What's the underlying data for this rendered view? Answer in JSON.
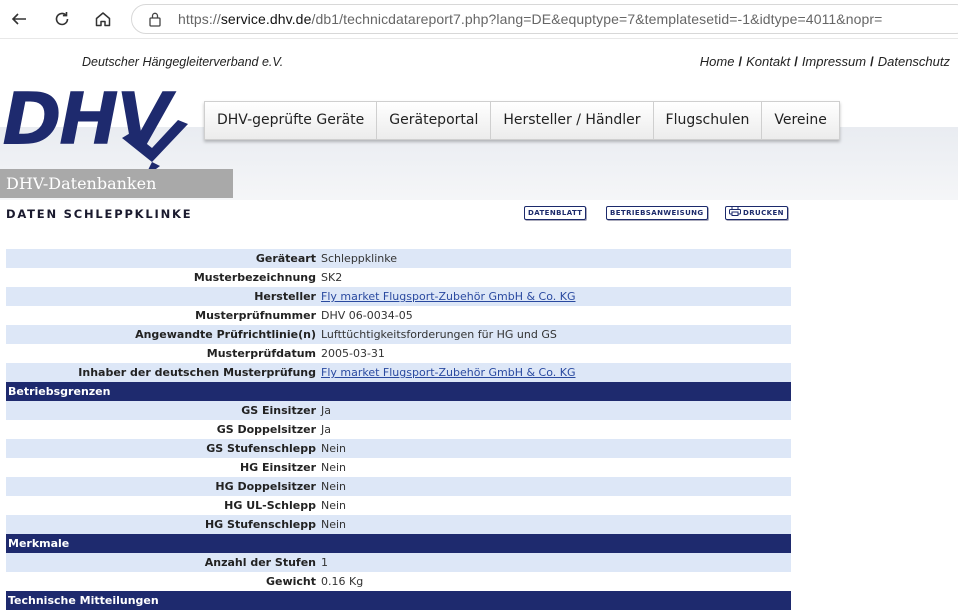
{
  "browser": {
    "url_prefix": "https://",
    "url_domain": "service.dhv.de",
    "url_rest": "/db1/technicdatareport7.php?lang=DE&equptype=7&templatesetid=-1&idtype=4011&nopr="
  },
  "site": {
    "org_name": "Deutscher Hängegleiterverband e.V.",
    "logo_text": "DHV",
    "db_title": "DHV-Datenbanken",
    "top_links": [
      "Home",
      "Kontakt",
      "Impressum",
      "Datenschutz"
    ],
    "menu": [
      "DHV-geprüfte Geräte",
      "Geräteportal",
      "Hersteller / Händler",
      "Flugschulen",
      "Vereine"
    ]
  },
  "page": {
    "title": "DATEN SCHLEPPKLINKE",
    "btn_datenblatt": "DATENBLATT",
    "btn_betrieb": "BETRIEBSANWEISUNG",
    "btn_drucken": "DRUCKEN"
  },
  "rows": [
    {
      "label": "Geräteart",
      "value": "Schleppklinke"
    },
    {
      "label": "Musterbezeichnung",
      "value": "SK2"
    },
    {
      "label": "Hersteller",
      "value": "Fly market Flugsport-Zubehör GmbH & Co. KG",
      "link": true
    },
    {
      "label": "Musterprüfnummer",
      "value": "DHV 06-0034-05"
    },
    {
      "label": "Angewandte Prüfrichtlinie(n)",
      "value": "Lufttüchtigkeitsforderungen für HG und GS"
    },
    {
      "label": "Musterprüfdatum",
      "value": "2005-03-31"
    },
    {
      "label": "Inhaber der deutschen Musterprüfung",
      "value": "Fly market Flugsport-Zubehör GmbH & Co. KG",
      "link": true
    },
    {
      "section": "Betriebsgrenzen"
    },
    {
      "label": "GS Einsitzer",
      "value": "Ja"
    },
    {
      "label": "GS Doppelsitzer",
      "value": "Ja"
    },
    {
      "label": "GS Stufenschlepp",
      "value": "Nein"
    },
    {
      "label": "HG Einsitzer",
      "value": "Nein"
    },
    {
      "label": "HG Doppelsitzer",
      "value": "Nein"
    },
    {
      "label": "HG UL-Schlepp",
      "value": "Nein"
    },
    {
      "label": "HG Stufenschlepp",
      "value": "Nein"
    },
    {
      "section": "Merkmale"
    },
    {
      "label": "Anzahl der Stufen",
      "value": "1"
    },
    {
      "label": "Gewicht",
      "value": "0.16 Kg"
    },
    {
      "section": "Technische Mitteilungen"
    }
  ],
  "colors": {
    "section_bg": "#1e2a6e",
    "row_alt": "#dde7f7",
    "link": "#2a4aa0",
    "logo_blue": "#1e2a6e"
  }
}
